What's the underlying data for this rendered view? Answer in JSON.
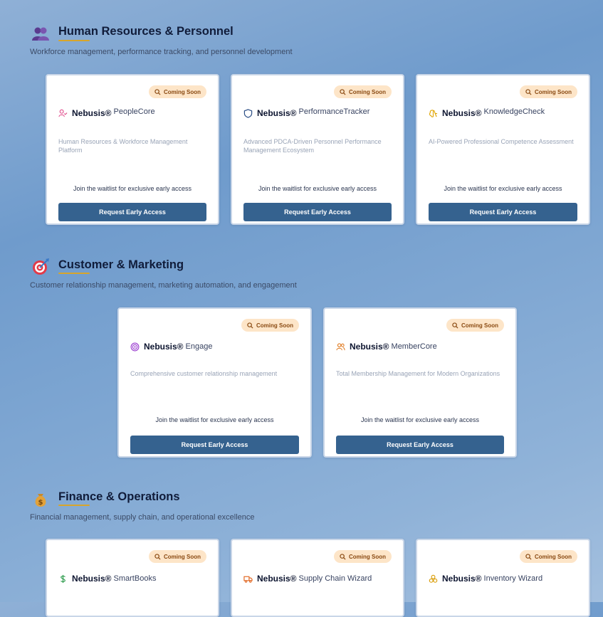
{
  "common": {
    "brand": "Nebusis®",
    "badge": "Coming Soon",
    "waitlist": "Join the waitlist for exclusive early access",
    "cta": "Request Early Access"
  },
  "colors": {
    "cta_bg": "#35628f",
    "badge_bg": "#fde5c8",
    "badge_text": "#8a4a12",
    "underline": "#d8a52a"
  },
  "sections": [
    {
      "title": "Human Resources & Personnel",
      "description": "Workforce management, performance tracking, and personnel development",
      "icon": "people-icon",
      "cards": [
        {
          "name": "PeopleCore",
          "icon": "user-check-icon",
          "description": "Human Resources & Workforce Management Platform"
        },
        {
          "name": "PerformanceTracker",
          "icon": "shield-icon",
          "description": "Advanced PDCA-Driven Personnel Performance Management Ecosystem"
        },
        {
          "name": "KnowledgeCheck",
          "icon": "brain-icon",
          "description": "AI-Powered Professional Competence Assessment"
        }
      ]
    },
    {
      "title": "Customer & Marketing",
      "description": "Customer relationship management, marketing automation, and engagement",
      "icon": "target-icon",
      "cards": [
        {
          "name": "Engage",
          "icon": "target-rings-icon",
          "description": "Comprehensive customer relationship management"
        },
        {
          "name": "MemberCore",
          "icon": "users-icon",
          "description": "Total Membership Management for Modern Organizations"
        }
      ]
    },
    {
      "title": "Finance & Operations",
      "description": "Financial management, supply chain, and operational excellence",
      "icon": "money-bag-icon",
      "cards": [
        {
          "name": "SmartBooks",
          "icon": "dollar-icon",
          "description": ""
        },
        {
          "name": "Supply Chain Wizard",
          "icon": "truck-icon",
          "description": ""
        },
        {
          "name": "Inventory Wizard",
          "icon": "boxes-icon",
          "description": ""
        }
      ]
    }
  ]
}
